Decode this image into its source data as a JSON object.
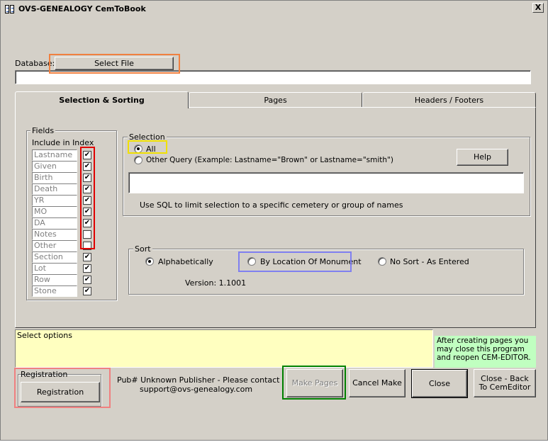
{
  "window": {
    "title": "OVS-GENEALOGY  CemToBook",
    "close_glyph": "X"
  },
  "database": {
    "label": "Database:",
    "select_button": "Select File",
    "path_value": ""
  },
  "tabs": [
    {
      "label": "Selection & Sorting",
      "active": true
    },
    {
      "label": "Pages",
      "active": false
    },
    {
      "label": "Headers / Footers",
      "active": false
    }
  ],
  "fields": {
    "group_label": "Fields",
    "header": "Include in Index",
    "items": [
      {
        "name": "Lastname",
        "checked": true
      },
      {
        "name": "Given",
        "checked": true
      },
      {
        "name": "Birth",
        "checked": true
      },
      {
        "name": "Death",
        "checked": true
      },
      {
        "name": "YR",
        "checked": true
      },
      {
        "name": "MO",
        "checked": true
      },
      {
        "name": "DA",
        "checked": true
      },
      {
        "name": "Notes",
        "checked": false
      },
      {
        "name": "Other",
        "checked": false
      },
      {
        "name": "Section",
        "checked": true
      },
      {
        "name": "Lot",
        "checked": true
      },
      {
        "name": "Row",
        "checked": true
      },
      {
        "name": "Stone",
        "checked": true
      }
    ]
  },
  "selection": {
    "group_label": "Selection",
    "all_label": "All",
    "other_query_label": "Other Query (Example: Lastname=\"Brown\" or Lastname=\"smith\")",
    "help_button": "Help",
    "query_value": "",
    "hint": "Use SQL to limit selection to a specific cemetery or group of names"
  },
  "sort": {
    "group_label": "Sort",
    "options": [
      "Alphabetically",
      "By Location Of Monument",
      "No Sort - As Entered"
    ],
    "selected": "Alphabetically"
  },
  "version": "Version: 1.1001",
  "status": {
    "text": "Select options",
    "note": "After creating pages you may close this program and reopen CEM-EDITOR."
  },
  "registration": {
    "group_label": "Registration",
    "button": "Registration"
  },
  "publisher": {
    "line1": "Pub#  Unknown Publisher - Please  contact",
    "line2": "support@ovs-genealogy.com"
  },
  "buttons": {
    "make_pages": "Make Pages",
    "cancel_make": "Cancel Make",
    "close": "Close",
    "close_back": "Close - Back To CemEditor"
  },
  "colors": {
    "window_bg": "#d4d0c8",
    "status_bg": "#ffffc0",
    "note_bg": "#c0ffc0",
    "highlight_orange": "#f08040",
    "highlight_red": "#e00000",
    "highlight_yellow": "#f0e000",
    "highlight_blue": "#8080f0",
    "highlight_pink": "#f08080",
    "highlight_green": "#008000"
  }
}
